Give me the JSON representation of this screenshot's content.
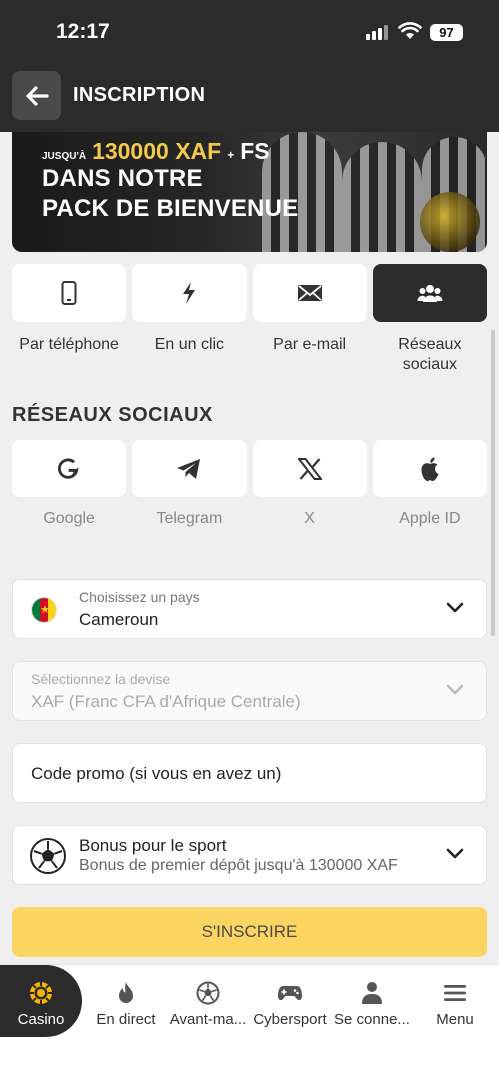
{
  "status_bar": {
    "time": "12:17",
    "battery": "97"
  },
  "header": {
    "title": "INSCRIPTION"
  },
  "banner": {
    "up_to": "JUSQU'À",
    "amount": "130000 XAF",
    "plus": "+",
    "fs": "FS",
    "line2": "DANS NOTRE",
    "line3": "PACK DE BIENVENUE"
  },
  "methods": [
    {
      "label": "Par téléphone",
      "icon": "phone-icon"
    },
    {
      "label": "En un clic",
      "icon": "lightning-icon"
    },
    {
      "label": "Par e-mail",
      "icon": "envelope-icon"
    },
    {
      "label": "Réseaux sociaux",
      "icon": "users-icon",
      "active": true
    }
  ],
  "socials_section": {
    "title": "RÉSEAUX SOCIAUX",
    "items": [
      {
        "label": "Google",
        "icon": "google-icon"
      },
      {
        "label": "Telegram",
        "icon": "telegram-icon"
      },
      {
        "label": "X",
        "icon": "x-icon"
      },
      {
        "label": "Apple ID",
        "icon": "apple-icon"
      }
    ]
  },
  "country_field": {
    "label": "Choisissez un pays",
    "value": "Cameroun"
  },
  "currency_field": {
    "label": "Sélectionnez la devise",
    "value": "XAF (Franc CFA d'Afrique Centrale)"
  },
  "promo_field": {
    "placeholder": "Code promo (si vous en avez un)"
  },
  "bonus_field": {
    "title": "Bonus pour le sport",
    "subtitle": "Bonus de premier dépôt jusqu'à 130000 XAF"
  },
  "register_button": {
    "label": "S'INSCRIRE"
  },
  "bottom_nav": [
    {
      "label": "Casino",
      "icon": "casino-chip-icon",
      "active": true
    },
    {
      "label": "En direct",
      "icon": "flame-icon"
    },
    {
      "label": "Avant-ma...",
      "icon": "soccer-ball-icon"
    },
    {
      "label": "Cybersport",
      "icon": "gamepad-icon"
    },
    {
      "label": "Se conne...",
      "icon": "user-icon"
    },
    {
      "label": "Menu",
      "icon": "hamburger-icon"
    }
  ],
  "colors": {
    "dark": "#2b2b2b",
    "accent_yellow": "#fbd462",
    "banner_gold": "#f2c94c",
    "casino_icon": "#f5b400"
  }
}
